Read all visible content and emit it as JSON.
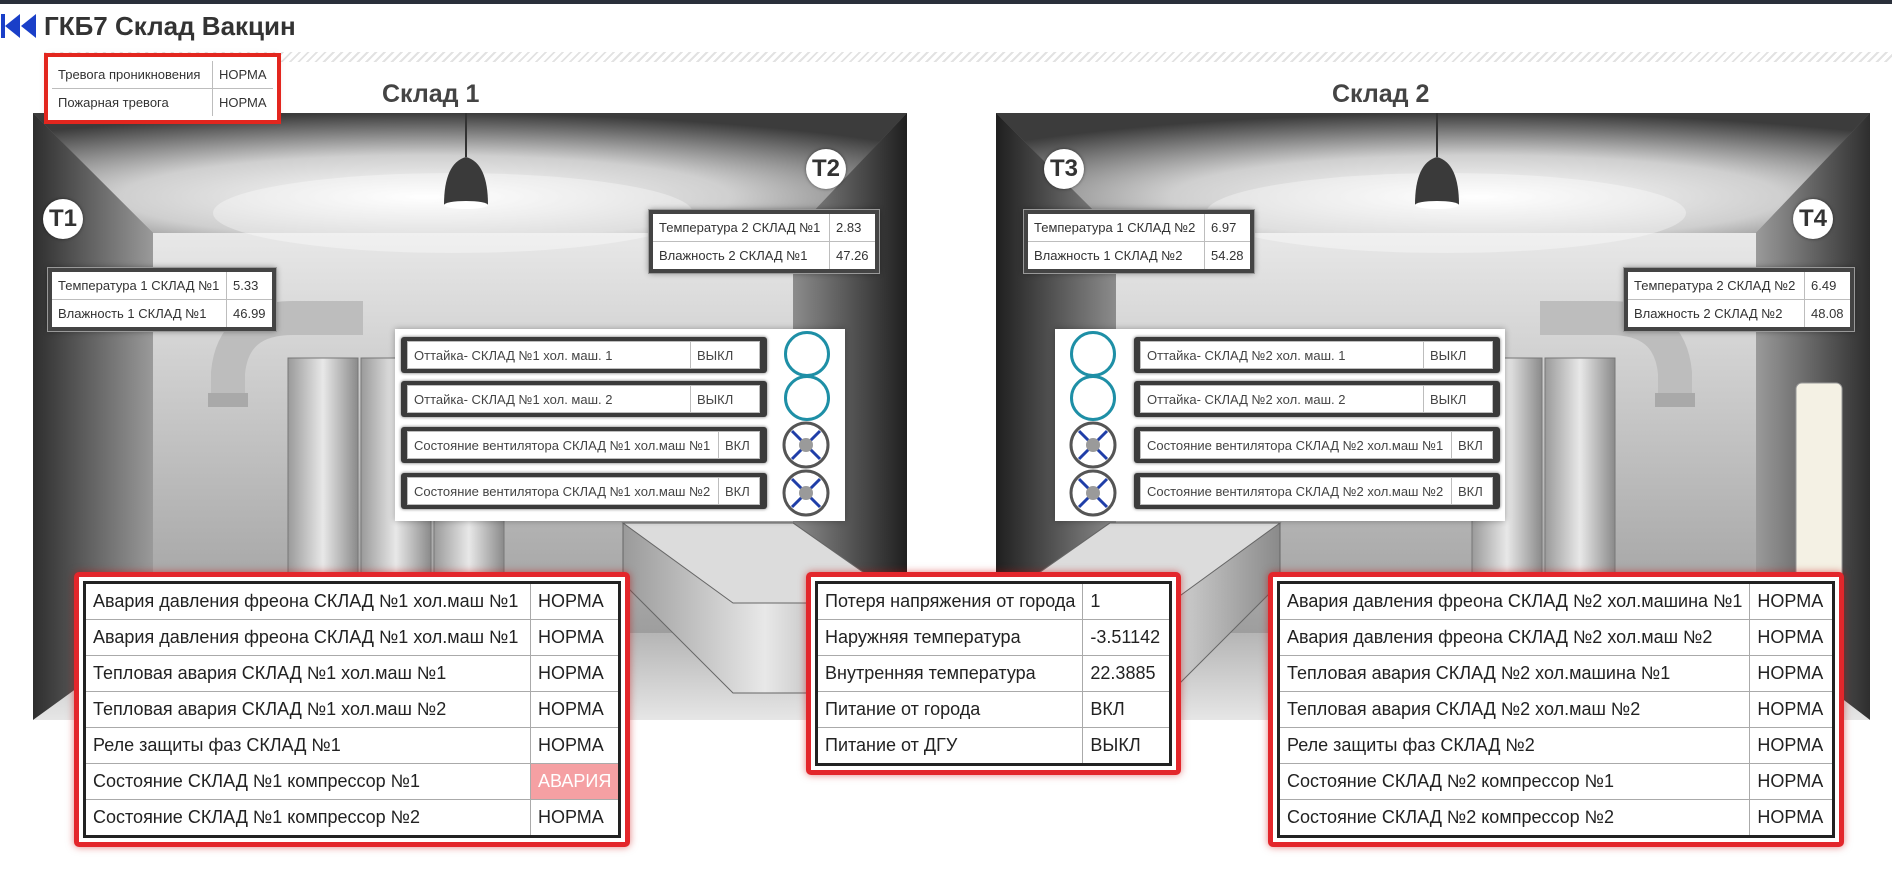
{
  "header": {
    "title": "ГКБ7 Склад Вакцин"
  },
  "alarms_top": [
    {
      "label": "Тревога проникновения",
      "value": "НОРМА"
    },
    {
      "label": "Пожарная тревога",
      "value": "НОРМА"
    }
  ],
  "warehouse1": {
    "title": "Склад 1",
    "t1": {
      "badge": "T1",
      "rows": [
        {
          "label": "Температура 1 СКЛАД №1",
          "value": "5.33"
        },
        {
          "label": "Влажность 1 СКЛАД №1",
          "value": "46.99"
        }
      ]
    },
    "t2": {
      "badge": "T2",
      "rows": [
        {
          "label": "Температура 2 СКЛАД №1",
          "value": "2.83"
        },
        {
          "label": "Влажность 2 СКЛАД №1",
          "value": "47.26"
        }
      ]
    },
    "controls": [
      {
        "label": "Оттайка- СКЛАД №1 хол. маш. 1",
        "value": "ВЫКЛ"
      },
      {
        "label": "Оттайка- СКЛАД №1 хол. маш. 2",
        "value": "ВЫКЛ"
      },
      {
        "label": "Состояние вентилятора СКЛАД №1 хол.маш №1",
        "value": "ВКЛ"
      },
      {
        "label": "Состояние вентилятора СКЛАД №1 хол.маш №2",
        "value": "ВКЛ"
      }
    ],
    "status": [
      {
        "label": "Авария давления фреона СКЛАД №1 хол.маш №1",
        "value": "НОРМА"
      },
      {
        "label": "Авария давления фреона СКЛАД №1 хол.маш №1",
        "value": "НОРМА"
      },
      {
        "label": "Тепловая авария СКЛАД №1 хол.маш №1",
        "value": "НОРМА"
      },
      {
        "label": "Тепловая авария СКЛАД №1 хол.маш №2",
        "value": "НОРМА"
      },
      {
        "label": "Реле защиты фаз СКЛАД №1",
        "value": "НОРМА"
      },
      {
        "label": "Состояние СКЛАД №1 компрессор №1",
        "value": "АВАРИЯ"
      },
      {
        "label": "Состояние СКЛАД №1 компрессор №2",
        "value": "НОРМА"
      }
    ]
  },
  "warehouse2": {
    "title": "Склад 2",
    "t3": {
      "badge": "T3",
      "rows": [
        {
          "label": "Температура 1 СКЛАД №2",
          "value": "6.97"
        },
        {
          "label": "Влажность 1 СКЛАД №2",
          "value": "54.28"
        }
      ]
    },
    "t4": {
      "badge": "T4",
      "rows": [
        {
          "label": "Температура 2 СКЛАД №2",
          "value": "6.49"
        },
        {
          "label": "Влажность 2 СКЛАД №2",
          "value": "48.08"
        }
      ]
    },
    "controls": [
      {
        "label": "Оттайка- СКЛАД №2 хол. маш. 1",
        "value": "ВЫКЛ"
      },
      {
        "label": "Оттайка- СКЛАД №2 хол. маш. 2",
        "value": "ВЫКЛ"
      },
      {
        "label": "Состояние вентилятора СКЛАД №2 хол.маш №1",
        "value": "ВКЛ"
      },
      {
        "label": "Состояние вентилятора СКЛАД №2 хол.маш №2",
        "value": "ВКЛ"
      }
    ],
    "status": [
      {
        "label": "Авария давления фреона СКЛАД №2 хол.машина №1",
        "value": "НОРМА"
      },
      {
        "label": "Авария давления фреона СКЛАД №2 хол.маш №2",
        "value": "НОРМА"
      },
      {
        "label": "Тепловая авария СКЛАД №2 хол.машина №1",
        "value": "НОРМА"
      },
      {
        "label": "Тепловая авария СКЛАД №2 хол.маш №2",
        "value": "НОРМА"
      },
      {
        "label": "Реле защиты фаз СКЛАД №2",
        "value": "НОРМА"
      },
      {
        "label": "Состояние СКЛАД №2 компрессор №1",
        "value": "НОРМА"
      },
      {
        "label": "Состояние СКЛАД №2 компрессор №2",
        "value": "НОРМА"
      }
    ]
  },
  "power": [
    {
      "label": "Потеря напряжения от города",
      "value": "1"
    },
    {
      "label": "Наружняя температура",
      "value": "-3.51142"
    },
    {
      "label": "Внутренняя температура",
      "value": "22.3885"
    },
    {
      "label": "Питание от города",
      "value": "ВКЛ"
    },
    {
      "label": "Питание от ДГУ",
      "value": "ВЫКЛ"
    }
  ],
  "colors": {
    "alarm_frame": "#e3262b",
    "alarm_cell": "#f5a0a3",
    "indicator": "#1e8fa6",
    "fan_blade": "#1f3ea8"
  }
}
